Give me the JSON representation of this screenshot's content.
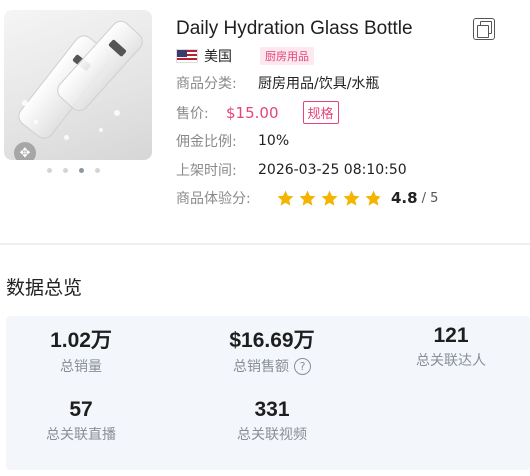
{
  "product": {
    "title": "Daily Hydration Glass Bottle",
    "country": "美国",
    "category_tag": "厨房用品",
    "fields": {
      "category_label": "商品分类:",
      "category_value": "厨房用品/饮具/水瓶",
      "price_label": "售价:",
      "price_value": "$15.00",
      "spec_button": "规格",
      "commission_label": "佣金比例:",
      "commission_value": "10%",
      "listed_label": "上架时间:",
      "listed_value": "2026-03-25 08:10:50",
      "rating_label": "商品体验分:",
      "rating_value": "4.8",
      "rating_max": "/ 5"
    },
    "rating_stars": 4.8,
    "image_carousel": {
      "count": 4,
      "active_index": 2
    }
  },
  "overview": {
    "title": "数据总览",
    "stats": [
      {
        "value": "1.02万",
        "label": "总销量"
      },
      {
        "value": "$16.69万",
        "label": "总销售额",
        "help": "?"
      },
      {
        "value": "121",
        "label": "总关联达人"
      },
      {
        "value": "57",
        "label": "总关联直播"
      },
      {
        "value": "331",
        "label": "总关联视频"
      }
    ]
  },
  "colors": {
    "accent": "#e5437b",
    "star": "#f5b400",
    "stats_bg": "#f3f6fa"
  },
  "icons": [
    "copy-icon",
    "us-flag-icon",
    "expand-icon",
    "star-icon",
    "help-icon"
  ]
}
